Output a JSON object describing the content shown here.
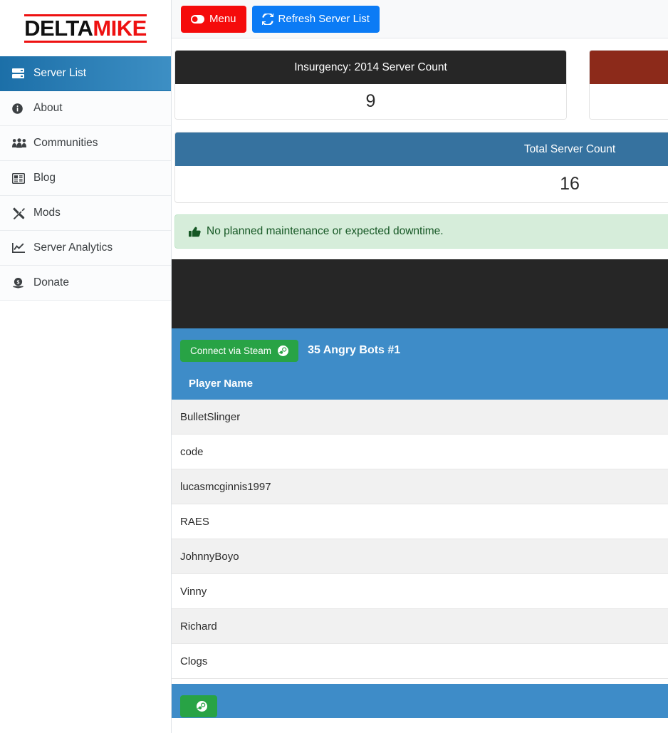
{
  "brand": {
    "part1": "DELTA",
    "part2": "MIKE"
  },
  "sidebar": {
    "items": [
      {
        "label": "Server List",
        "icon": "server-icon",
        "active": true
      },
      {
        "label": "About",
        "icon": "info-circle-icon",
        "active": false
      },
      {
        "label": "Communities",
        "icon": "users-icon",
        "active": false
      },
      {
        "label": "Blog",
        "icon": "newspaper-icon",
        "active": false
      },
      {
        "label": "Mods",
        "icon": "tools-icon",
        "active": false
      },
      {
        "label": "Server Analytics",
        "icon": "chart-line-icon",
        "active": false
      },
      {
        "label": "Donate",
        "icon": "money-icon",
        "active": false
      }
    ]
  },
  "toolbar": {
    "menu_label": "Menu",
    "menu_icon": "toggle-on-icon",
    "menu_color": "#f50b0b",
    "refresh_label": "Refresh Server List",
    "refresh_icon": "refresh-icon",
    "refresh_color": "#0b7bf5"
  },
  "cards": [
    {
      "title": "Insurgency: 2014 Server Count",
      "value": "9",
      "header_color": "#262626"
    },
    {
      "title": "",
      "value": "",
      "header_color": "#8c2a1a"
    }
  ],
  "total": {
    "title": "Total Server Count",
    "value": "16",
    "header_color": "#36729f"
  },
  "alert": {
    "icon": "thumbs-up-icon",
    "text": "No planned maintenance or expected downtime.",
    "bg_color": "#d6edda",
    "text_color": "#155724"
  },
  "servers": [
    {
      "name": "35 Angry Bots #1",
      "connect_label": "Connect via Steam",
      "connect_icon": "steam-icon",
      "column_header": "Player Name",
      "players": [
        "BulletSlinger",
        "code",
        "lucasmcginnis1997",
        "RAES",
        "JohnnyBoyo",
        "Vinny",
        "Richard",
        "Clogs"
      ]
    },
    {
      "name": "",
      "connect_label": "",
      "connect_icon": "steam-icon",
      "column_header": "",
      "players": []
    }
  ]
}
